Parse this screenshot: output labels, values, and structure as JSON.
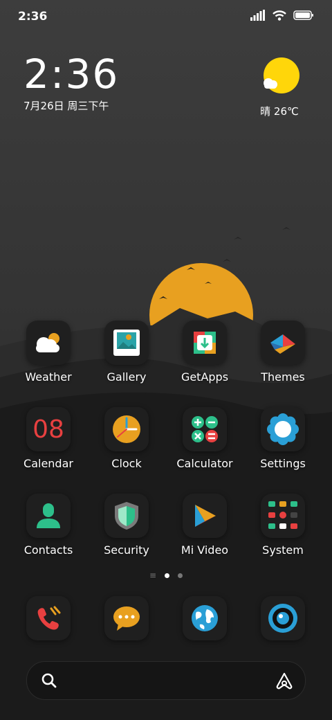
{
  "status_bar": {
    "time": "2:36"
  },
  "clock_widget": {
    "time": "2:36",
    "date": "7月26日 周三下午"
  },
  "weather_widget": {
    "condition": "晴",
    "temperature": "26℃"
  },
  "apps": [
    {
      "label": "Weather",
      "icon": "weather-icon"
    },
    {
      "label": "Gallery",
      "icon": "gallery-icon"
    },
    {
      "label": "GetApps",
      "icon": "getapps-icon"
    },
    {
      "label": "Themes",
      "icon": "themes-icon"
    },
    {
      "label": "Calendar",
      "icon": "calendar-icon",
      "icon_text": "08"
    },
    {
      "label": "Clock",
      "icon": "clock-icon"
    },
    {
      "label": "Calculator",
      "icon": "calculator-icon"
    },
    {
      "label": "Settings",
      "icon": "settings-icon"
    },
    {
      "label": "Contacts",
      "icon": "contacts-icon"
    },
    {
      "label": "Security",
      "icon": "security-icon"
    },
    {
      "label": "Mi Video",
      "icon": "mi-video-icon"
    },
    {
      "label": "System",
      "icon": "folder-icon"
    }
  ],
  "page_indicator": {
    "pages": 2,
    "current": 1
  },
  "dock": [
    {
      "icon": "phone-icon"
    },
    {
      "icon": "messages-icon"
    },
    {
      "icon": "browser-icon"
    },
    {
      "icon": "camera-icon"
    }
  ],
  "search_bar": {
    "left_icon": "search-icon",
    "right_icon": "assistant-icon"
  },
  "colors": {
    "sun": "#e8a020",
    "accent_red": "#e84040",
    "accent_green": "#2dbf8a",
    "accent_blue": "#2a9fd6"
  }
}
